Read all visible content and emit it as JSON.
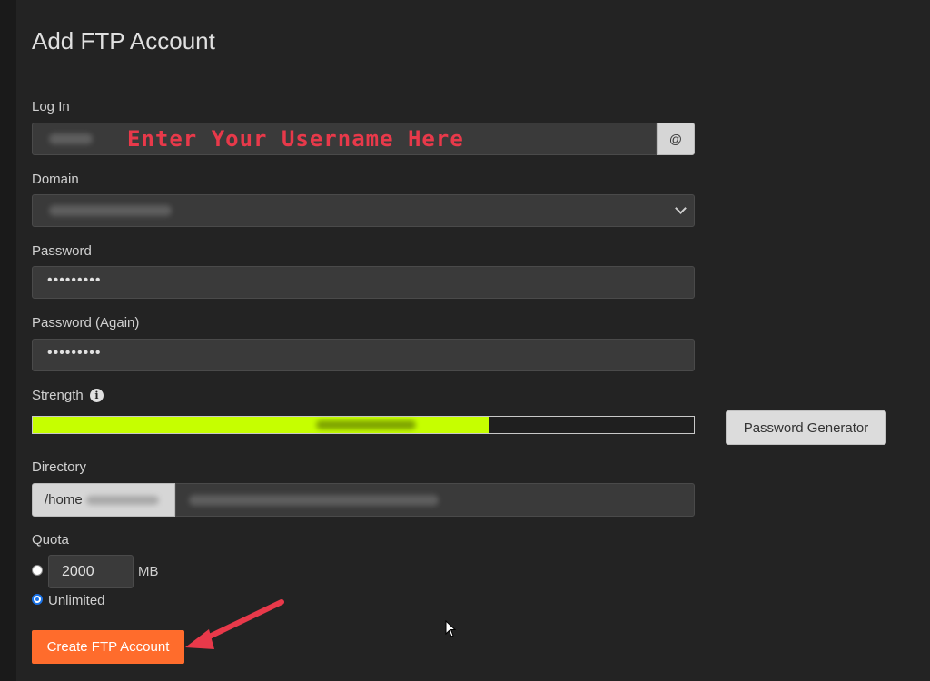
{
  "page": {
    "title": "Add FTP Account"
  },
  "login": {
    "label": "Log In",
    "annotation": "Enter Your Username Here",
    "addon": "@"
  },
  "domain": {
    "label": "Domain"
  },
  "password": {
    "label": "Password",
    "masked_value": "•••••••••"
  },
  "password_again": {
    "label": "Password (Again)",
    "masked_value": "•••••••••"
  },
  "strength": {
    "label": "Strength",
    "info_icon": "info-circle-icon",
    "level": 0.69,
    "bar_color": "#c6ff00",
    "generator_label": "Password Generator"
  },
  "directory": {
    "label": "Directory",
    "prefix": "/home"
  },
  "quota": {
    "label": "Quota",
    "value": "2000",
    "unit": "MB",
    "unlimited_label": "Unlimited",
    "selected": "unlimited"
  },
  "submit": {
    "label": "Create FTP Account",
    "color": "#ff6c2c"
  },
  "annotation": {
    "arrow_color": "#e8394a"
  }
}
